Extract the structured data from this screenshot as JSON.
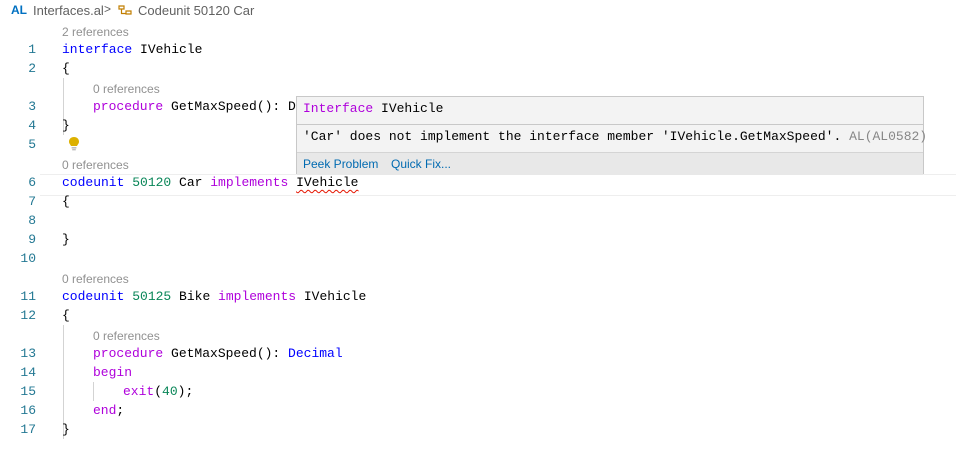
{
  "breadcrumb": {
    "lang": "AL",
    "file": "Interfaces.al",
    "separator": ">",
    "object": "Codeunit 50120 Car"
  },
  "lenses": {
    "l1": "2 references",
    "l3": "0 references",
    "l6": "0 references",
    "l11": "0 references",
    "l13": "0 references"
  },
  "lines": {
    "n1": "1",
    "n2": "2",
    "n3": "3",
    "n4": "4",
    "n5": "5",
    "n6": "6",
    "n7": "7",
    "n8": "8",
    "n9": "9",
    "n10": "10",
    "n11": "11",
    "n12": "12",
    "n13": "13",
    "n14": "14",
    "n15": "15",
    "n16": "16",
    "n17": "17"
  },
  "code": {
    "interface_kw": "interface",
    "interface_name": " IVehicle",
    "brace_open": "{",
    "brace_close": "}",
    "procedure_kw": "procedure",
    "proc_sig_partial": " GetMaxSpeed(): D",
    "codeunit_kw": "codeunit",
    "car_id": " 50120",
    "car_name": " Car ",
    "implements_kw": "implements",
    "car_iface": "IVehicle",
    "bike_id": " 50125",
    "bike_name": " Bike ",
    "bike_iface": " IVehicle",
    "proc_sig": " GetMaxSpeed(): ",
    "decimal_type": "Decimal",
    "begin_kw": "begin",
    "exit_kw": "exit",
    "exit_args_open": "(",
    "exit_value": "40",
    "exit_args_close": ");",
    "end_kw": "end",
    "end_semicolon": ";"
  },
  "hover": {
    "title_kw": "Interface",
    "title_name": " IVehicle",
    "message": "'Car' does not implement the interface member 'IVehicle.GetMaxSpeed'. ",
    "diag_code": "AL(AL0582)",
    "peek_label": "Peek Problem",
    "quickfix_label": "Quick Fix..."
  },
  "icons": {
    "object": "codeunit-symbol-icon",
    "lightbulb": "lightbulb-icon"
  }
}
